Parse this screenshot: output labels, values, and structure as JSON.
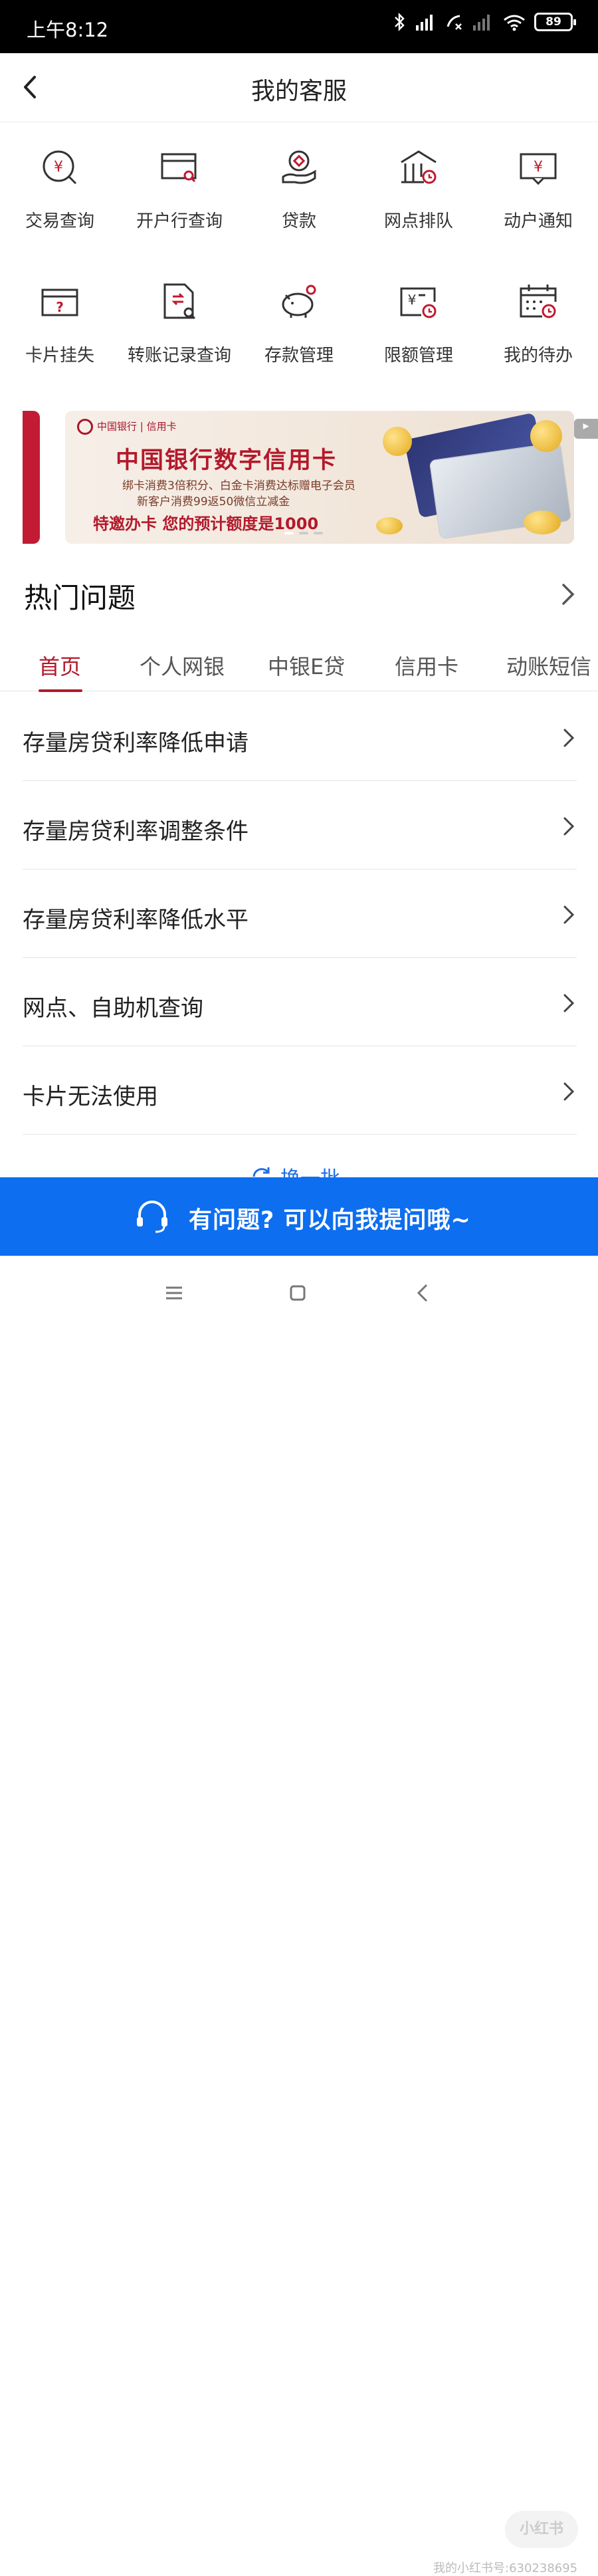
{
  "status_bar": {
    "time": "上午8:12",
    "battery": "89"
  },
  "header": {
    "title": "我的客服",
    "back_icon": "chevron-left-icon"
  },
  "services": [
    {
      "label": "交易查询",
      "icon": "yuan-search-icon"
    },
    {
      "label": "开户行查询",
      "icon": "card-search-icon"
    },
    {
      "label": "贷款",
      "icon": "hand-coin-icon"
    },
    {
      "label": "网点排队",
      "icon": "bank-clock-icon"
    },
    {
      "label": "动户通知",
      "icon": "yuan-notice-icon"
    },
    {
      "label": "卡片挂失",
      "icon": "card-question-icon"
    },
    {
      "label": "转账记录查询",
      "icon": "transfer-doc-icon"
    },
    {
      "label": "存款管理",
      "icon": "piggy-bank-icon"
    },
    {
      "label": "限额管理",
      "icon": "limit-icon"
    },
    {
      "label": "我的待办",
      "icon": "calendar-clock-icon"
    }
  ],
  "banner": {
    "logo_text": "中国银行 | 信用卡",
    "headline": "中国银行数字信用卡",
    "line1": "绑卡消费3倍积分、白金卡消费达标赠电子会员",
    "line2": "新客户消费99返50微信立减金",
    "cta": "特邀办卡   您的预计额度是1000"
  },
  "hot": {
    "title": "热门问题"
  },
  "tabs": [
    "首页",
    "个人网银",
    "中银E贷",
    "信用卡",
    "动账短信"
  ],
  "active_tab": "首页",
  "questions": [
    "存量房贷利率降低申请",
    "存量房贷利率调整条件",
    "存量房贷利率降低水平",
    "网点、自助机查询",
    "卡片无法使用"
  ],
  "refresh_label": "换一批",
  "ask_bar": {
    "text": "有问题? 可以向我提问哦~"
  },
  "watermark": "我的小红书号:630238695",
  "watermark_logo": "小红书",
  "colors": {
    "brand_red": "#b3192c",
    "ask_blue": "#0d6ef0"
  }
}
